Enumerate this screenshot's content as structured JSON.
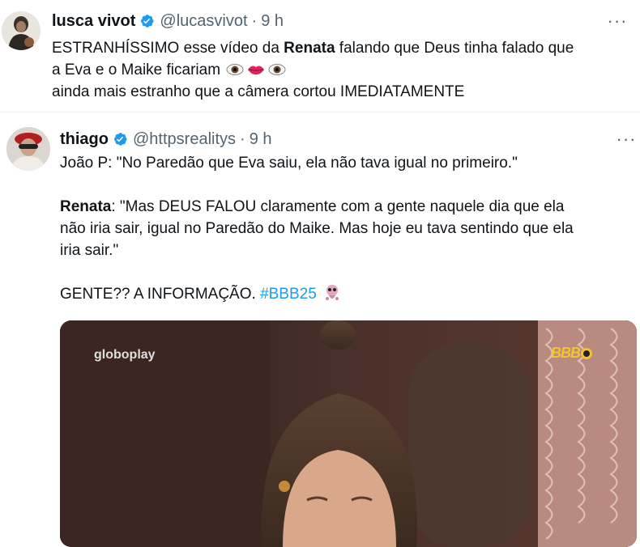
{
  "tweet1": {
    "display_name": "lusca vivot",
    "handle": "@lucasvivot",
    "separator": "·",
    "time": "9 h",
    "line1_prefix": "ESTRANHÍSSIMO esse vídeo da ",
    "line1_bold": "Renata",
    "line1_suffix": " falando que Deus tinha falado que",
    "line2": "a Eva e o Maike ficariam",
    "line3": "ainda mais estranho que a câmera cortou IMEDIATAMENTE",
    "emojis": [
      "eyes-emoji",
      "lips-emoji",
      "eyes-emoji"
    ]
  },
  "tweet2": {
    "display_name": "thiago",
    "handle": "@httpsrealitys",
    "separator": "·",
    "time": "9 h",
    "para1": "João P: \"No Paredão que Eva saiu, ela não tava igual no primeiro.\"",
    "para2_bold": "Renata",
    "para2_line1": ": \"Mas DEUS FALOU claramente com a gente naquele dia que ela",
    "para2_line2": "não iria sair, igual no Paredão do Maike. Mas hoje eu tava sentindo que ela",
    "para2_line3": "iria sair.\"",
    "para3_text": "GENTE?? A INFORMAÇÃO. ",
    "para3_hashtag": "#BBB25",
    "media": {
      "watermark": "globoplay",
      "logo": "BBB"
    }
  },
  "more_icon": "···",
  "colors": {
    "text": "#0f1419",
    "secondary": "#536471",
    "link": "#1d9bf0",
    "verified": "#1d9bf0"
  }
}
